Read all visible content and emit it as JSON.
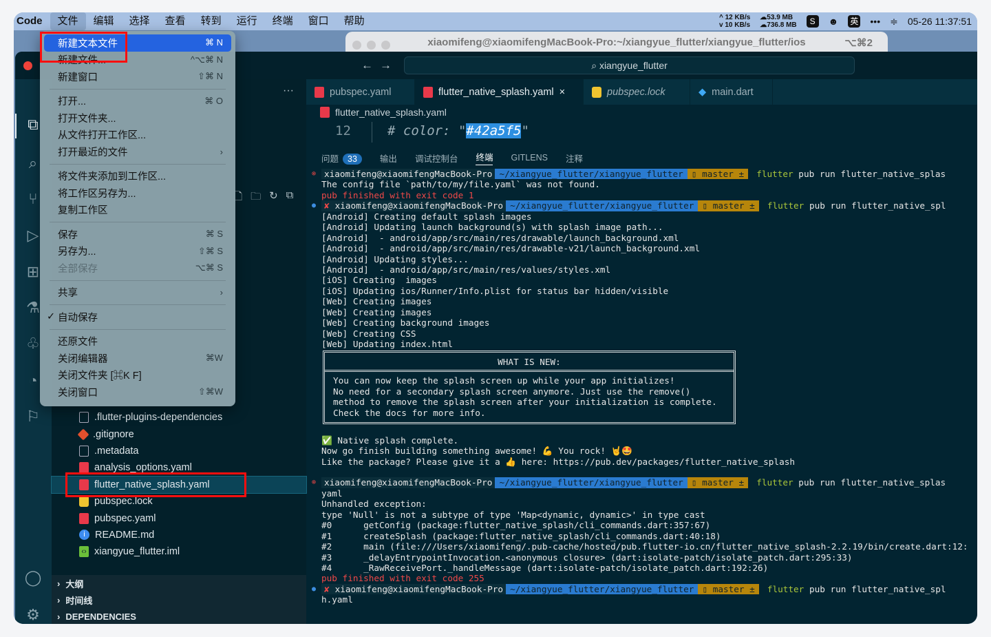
{
  "menubar": {
    "app": "Code",
    "items": [
      "文件",
      "编辑",
      "选择",
      "查看",
      "转到",
      "运行",
      "终端",
      "窗口",
      "帮助"
    ],
    "status": {
      "up": "^ 12 KB/s",
      "down": "v 10 KB/s",
      "mem1": "53.9 MB",
      "mem2": "736.8 MB",
      "ime": "英",
      "more": "•••",
      "datetime": "05-26 11:37:51"
    }
  },
  "terminal_window": {
    "title": "xiaomifeng@xiaomifengMacBook-Pro:~/xiangyue_flutter/xiangyue_flutter/ios",
    "shortcut": "⌥⌘2"
  },
  "vscode": {
    "search": "xiangyue_flutter",
    "more": "···",
    "tabs": [
      {
        "label": "pubspec.yaml"
      },
      {
        "label": "flutter_native_splash.yaml",
        "close": "×"
      },
      {
        "label": "pubspec.lock"
      },
      {
        "label": "main.dart"
      }
    ],
    "breadcrumb": "flutter_native_splash.yaml",
    "code": {
      "line": "12",
      "prefix": "# color: \"",
      "selected": "#42a5f5",
      "suffix": "\""
    },
    "panel_tabs": {
      "problems": "问题",
      "problems_count": "33",
      "output": "输出",
      "debug": "调试控制台",
      "terminal": "终端",
      "gitlens": "GITLENS",
      "comments": "注释"
    },
    "files": [
      ".flutter-plugins-dependencies",
      ".gitignore",
      ".metadata",
      "analysis_options.yaml",
      "flutter_native_splash.yaml",
      "pubspec.lock",
      "pubspec.yaml",
      "README.md",
      "xiangyue_flutter.iml"
    ],
    "sections": [
      "大纲",
      "时间线",
      "DEPENDENCIES"
    ]
  },
  "file_menu": [
    {
      "label": "新建文本文件",
      "shortcut": "⌘ N"
    },
    {
      "label": "新建文件...",
      "shortcut": "^⌥⌘ N"
    },
    {
      "label": "新建窗口",
      "shortcut": "⇧⌘ N"
    },
    {
      "label": "打开...",
      "shortcut": "⌘ O"
    },
    {
      "label": "打开文件夹..."
    },
    {
      "label": "从文件打开工作区..."
    },
    {
      "label": "打开最近的文件",
      "shortcut": "›"
    },
    {
      "label": "将文件夹添加到工作区..."
    },
    {
      "label": "将工作区另存为..."
    },
    {
      "label": "复制工作区"
    },
    {
      "label": "保存",
      "shortcut": "⌘ S"
    },
    {
      "label": "另存为...",
      "shortcut": "⇧⌘ S"
    },
    {
      "label": "全部保存",
      "shortcut": "⌥⌘ S"
    },
    {
      "label": "共享",
      "shortcut": "›"
    },
    {
      "label": "自动保存",
      "check": "✓"
    },
    {
      "label": "还原文件"
    },
    {
      "label": "关闭编辑器",
      "shortcut": "⌘W"
    },
    {
      "label": "关闭文件夹 [⌘K F]"
    },
    {
      "label": "关闭窗口",
      "shortcut": "⇧⌘W"
    }
  ],
  "prompt": {
    "user": "xiaomifeng@xiaomifengMacBook-Pro",
    "dir": "~/xiangyue_flutter/xiangyue_flutter",
    "branch": "▯ master ±",
    "cmd": "flutter",
    "args1": " pub run flutter_native_splas",
    "args2": " pub run flutter_native_spl",
    "err": "⊗",
    "x": "✘",
    "dot": "●"
  },
  "term": {
    "b1": [
      "The config file `path/to/my/file.yaml` was not found."
    ],
    "exit1": "pub finished with exit code 1",
    "b2": [
      "[Android] Creating default splash images",
      "[Android] Updating launch background(s) with splash image path...",
      "[Android]  - android/app/src/main/res/drawable/launch_background.xml",
      "[Android]  - android/app/src/main/res/drawable-v21/launch_background.xml",
      "[Android] Updating styles...",
      "[Android]  - android/app/src/main/res/values/styles.xml",
      "[iOS] Creating  images",
      "[iOS] Updating ios/Runner/Info.plist for status bar hidden/visible",
      "[Web] Creating images",
      "[Web] Creating images",
      "[Web] Creating background images",
      "[Web] Creating CSS",
      "[Web] Updating index.html"
    ],
    "box_title": "WHAT IS NEW:",
    "box_body": [
      "You can now keep the splash screen up while your app initializes!",
      "No need for a secondary splash screen anymore. Just use the remove()",
      "method to remove the splash screen after your initialization is complete.",
      "Check the docs for more info."
    ],
    "b3": [
      "✅ Native splash complete.",
      "Now go finish building something awesome! 💪 You rock! 🤘🤩",
      "Like the package? Please give it a 👍 here: https://pub.dev/packages/flutter_native_splash"
    ],
    "b4": [
      "yaml",
      "Unhandled exception:",
      "type 'Null' is not a subtype of type 'Map<dynamic, dynamic>' in type cast",
      "#0      getConfig (package:flutter_native_splash/cli_commands.dart:357:67)",
      "#1      createSplash (package:flutter_native_splash/cli_commands.dart:40:18)",
      "#2      main (file:///Users/xiaomifeng/.pub-cache/hosted/pub.flutter-io.cn/flutter_native_splash-2.2.19/bin/create.dart:12:",
      "#3      _delayEntrypointInvocation.<anonymous closure> (dart:isolate-patch/isolate_patch.dart:295:33)",
      "#4      _RawReceivePort._handleMessage (dart:isolate-patch/isolate_patch.dart:192:26)"
    ],
    "exit2": "pub finished with exit code 255",
    "b5": [
      "h.yaml"
    ]
  }
}
